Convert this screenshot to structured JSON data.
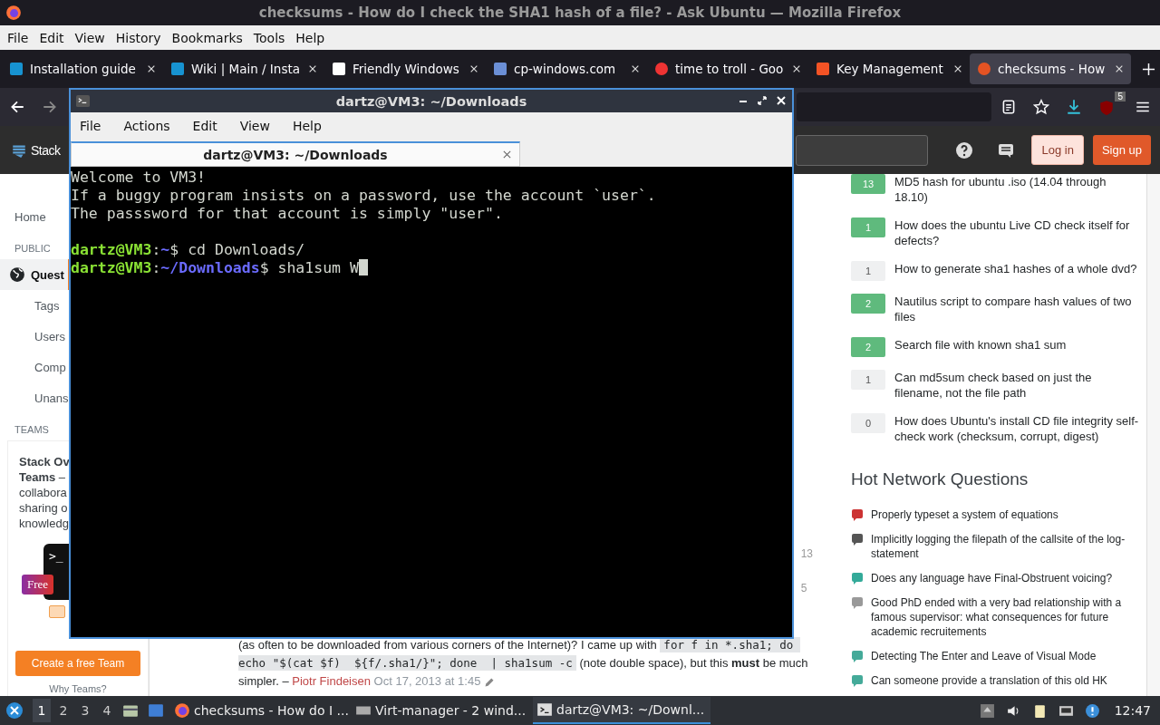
{
  "browser": {
    "title": "checksums - How do I check the SHA1 hash of a file? - Ask Ubuntu — Mozilla Firefox",
    "menu": [
      "File",
      "Edit",
      "View",
      "History",
      "Bookmarks",
      "Tools",
      "Help"
    ],
    "tabs": [
      {
        "label": "Installation guide",
        "selected": false
      },
      {
        "label": "Wiki | Main / Insta",
        "selected": false
      },
      {
        "label": "Friendly Windows",
        "selected": false
      },
      {
        "label": "cp-windows.com",
        "selected": false
      },
      {
        "label": "time to troll - Goo",
        "selected": false
      },
      {
        "label": "Key Management",
        "selected": false
      },
      {
        "label": "checksums - How",
        "selected": true
      }
    ],
    "addon_badge": "5"
  },
  "site_header": {
    "logo": "Stack",
    "login": "Log in",
    "signup": "Sign up"
  },
  "left_nav": [
    {
      "kind": "link",
      "label": "Home",
      "selected": false
    },
    {
      "kind": "heading",
      "label": "PUBLIC"
    },
    {
      "kind": "primary",
      "label": "Quest",
      "selected": true
    },
    {
      "kind": "sub",
      "label": "Tags",
      "selected": false
    },
    {
      "kind": "sub",
      "label": "Users",
      "selected": false
    },
    {
      "kind": "sub",
      "label": "Comp",
      "selected": false
    },
    {
      "kind": "sub",
      "label": "Unans",
      "selected": false
    },
    {
      "kind": "heading",
      "label": "TEAMS"
    }
  ],
  "teams": {
    "text": "**Stack Ov**\n**Teams** –\ncollabora\nsharing o\nknowledg",
    "prompt": ">_",
    "badge": "Free",
    "button": "Create a free Team",
    "link": "Why Teams?"
  },
  "comment": {
    "before": "(as often to be downloaded from various corners of the Internet)? I came up with ",
    "code": "for f in *.sha1; do echo \"$(cat $f)  ${f/.sha1/}\"; done  | sha1sum -c",
    "after": " (note double space), but this **must** be much simpler. – ",
    "author": "Piotr Findeisen",
    "date": "Oct 17, 2013 at 1:45"
  },
  "main_fragments": [
    "13",
    "5"
  ],
  "linked": [
    {
      "score": "13",
      "accepted": true,
      "title": "MD5 hash for ubuntu .iso (14.04 through 18.10)"
    },
    {
      "score": "1",
      "accepted": true,
      "title": "How does the ubuntu Live CD check itself for defects?"
    },
    {
      "score": "1",
      "accepted": false,
      "title": "How to generate sha1 hashes of a whole dvd?"
    },
    {
      "score": "2",
      "accepted": true,
      "title": "Nautilus script to compare hash values of two files"
    },
    {
      "score": "2",
      "accepted": true,
      "title": "Search file with known sha1 sum"
    },
    {
      "score": "1",
      "accepted": false,
      "title": "Can md5sum check based on just the filename, not the file path"
    },
    {
      "score": "0",
      "accepted": false,
      "title": "How does Ubuntu's install CD file integrity self-check work (checksum, corrupt, digest)"
    }
  ],
  "hot": {
    "heading": "Hot Network Questions",
    "items": [
      {
        "title": "Properly typeset a system of equations"
      },
      {
        "title": "Implicitly logging the filepath of the callsite of the log-statement"
      },
      {
        "title": "Does any language have Final-Obstruent voicing?"
      },
      {
        "title": "Good PhD ended with a very bad relationship with a famous supervisor: what consequences for future academic recruitements"
      },
      {
        "title": "Detecting The Enter and Leave of Visual Mode"
      },
      {
        "title": "Can someone provide a translation of this old HK"
      }
    ]
  },
  "terminal": {
    "title": "dartz@VM3: ~/Downloads",
    "menu": [
      "File",
      "Actions",
      "Edit",
      "View",
      "Help"
    ],
    "tab": {
      "label": "dartz@VM3: ~/Downloads",
      "selected": true
    },
    "lines": [
      {
        "kind": "output",
        "text": "Welcome to VM3!"
      },
      {
        "kind": "output",
        "text": "If a buggy program insists on a password, use the account `user`."
      },
      {
        "kind": "output",
        "text": "The passsword for that account is simply \"user\"."
      },
      {
        "kind": "blank"
      },
      {
        "kind": "prompt",
        "user": "dartz@VM3",
        "sep": ":",
        "path": "~",
        "command": "$ cd Downloads/"
      },
      {
        "kind": "prompt",
        "user": "dartz@VM3",
        "sep": ":",
        "path": "~/Downloads",
        "command": "$ sha1sum W"
      }
    ],
    "cursor": true
  },
  "taskbar": {
    "workspaces": [
      {
        "label": "1",
        "selected": true
      },
      {
        "label": "2",
        "selected": false
      },
      {
        "label": "3",
        "selected": false
      },
      {
        "label": "4",
        "selected": false
      }
    ],
    "windows": [
      {
        "label": "checksums - How do I ...",
        "selected": false
      },
      {
        "label": "Virt-manager - 2 wind...",
        "selected": false
      },
      {
        "label": "dartz@VM3: ~/Downl...",
        "selected": true
      }
    ],
    "clock": "12:47"
  }
}
